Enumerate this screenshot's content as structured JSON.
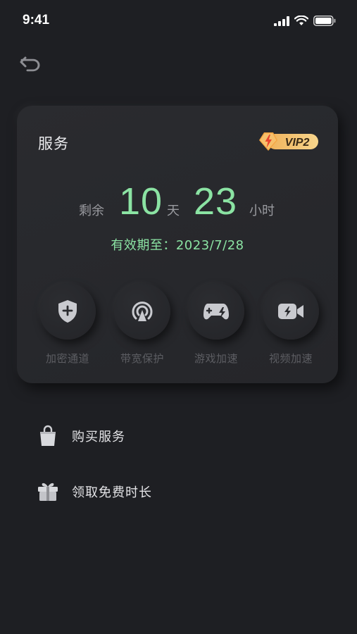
{
  "status_bar": {
    "time": "9:41"
  },
  "card": {
    "title": "服务",
    "vip_badge": "VIP2",
    "remain_prefix": "剩余",
    "days_value": "10",
    "days_unit": "天",
    "hours_value": "23",
    "hours_unit": "小时",
    "expiry": "有效期至：2023/7/28"
  },
  "features": [
    {
      "label": "加密通道",
      "icon": "shield-plus-icon"
    },
    {
      "label": "带宽保护",
      "icon": "broadcast-icon"
    },
    {
      "label": "游戏加速",
      "icon": "gamepad-bolt-icon"
    },
    {
      "label": "视频加速",
      "icon": "video-bolt-icon"
    }
  ],
  "menu": [
    {
      "label": "购买服务",
      "icon": "shopping-bag-icon"
    },
    {
      "label": "领取免费时长",
      "icon": "gift-icon"
    }
  ],
  "colors": {
    "accent_green": "#8be3a3",
    "background": "#1e1f23",
    "card": "#2a2b2f",
    "vip_orange": "#f2b04a"
  }
}
